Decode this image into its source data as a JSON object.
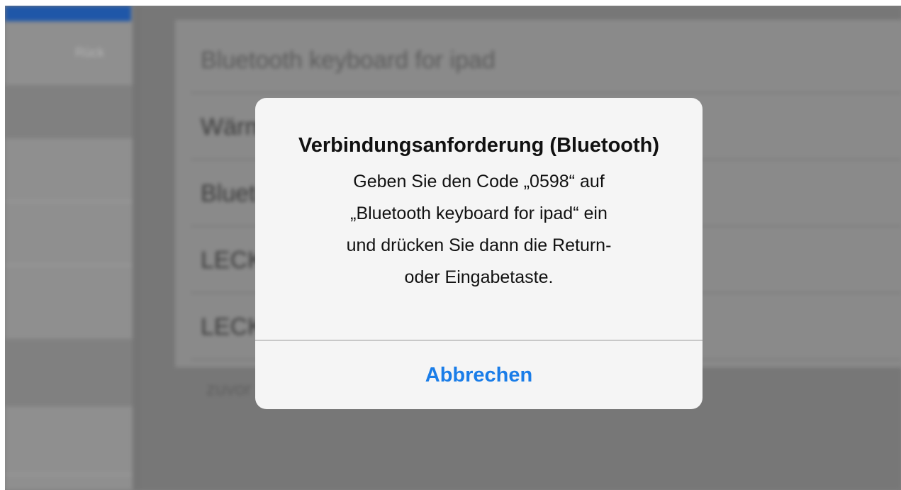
{
  "background": {
    "sidebar_label": "Rück",
    "rows": [
      "Bluetooth keyboard for ipad",
      "Wärmelade",
      "Bluetooth keyboard for ipad",
      "LECKE",
      "LECKE_V"
    ],
    "footer_text": "zuvor sichtbar"
  },
  "alert": {
    "title": "Verbindungsanforderung (Bluetooth)",
    "message": "Geben Sie den Code „0598“ auf\n„Bluetooth keyboard for ipad“ ein\nund drücken Sie dann die Return-\noder Eingabetaste.",
    "button_label": "Abbrechen"
  },
  "colors": {
    "accent": "#1a7de8",
    "alert_bg": "#f5f5f5",
    "dim_overlay": "#7f7f7f"
  }
}
